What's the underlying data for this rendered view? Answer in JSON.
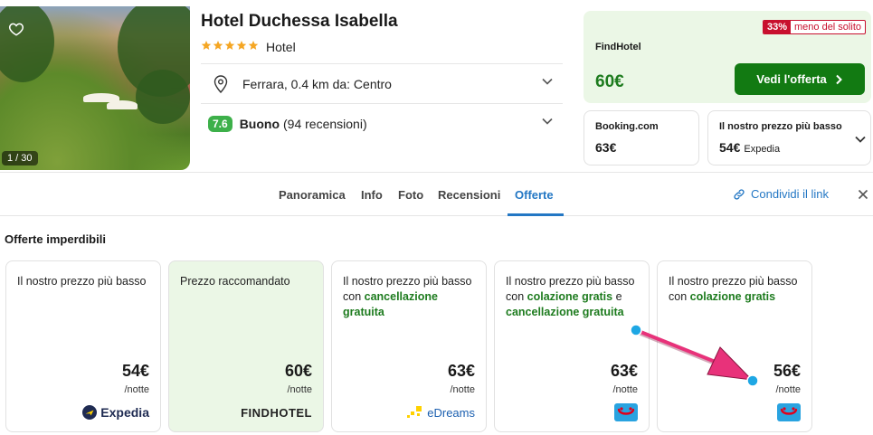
{
  "hotel": {
    "name": "Hotel Duchessa Isabella",
    "type": "Hotel",
    "star_count": 5,
    "photo_counter": "1 / 30",
    "location": "Ferrara, 0.4 km da: Centro",
    "rating_score": "7.6",
    "rating_word": "Buono",
    "reviews": "(94 recensioni)"
  },
  "top_deal": {
    "discount_pct": "33%",
    "discount_label": "meno del solito",
    "provider": "FindHotel",
    "price": "60€",
    "button_label": "Vedi l'offerta"
  },
  "other_prices": [
    {
      "provider": "Booking.com",
      "price": "63€",
      "sub": ""
    },
    {
      "provider": "Il nostro prezzo più basso",
      "price": "54€",
      "sub": "Expedia"
    }
  ],
  "tabs": [
    "Panoramica",
    "Info",
    "Foto",
    "Recensioni",
    "Offerte"
  ],
  "active_tab": "Offerte",
  "share_label": "Condividi il link",
  "section_title": "Offerte imperdibili",
  "offers": [
    {
      "desc_plain": "Il nostro prezzo più basso",
      "price": "54€",
      "unit": "/notte",
      "logo": "Expedia"
    },
    {
      "desc_plain": "Prezzo raccomandato",
      "price": "60€",
      "unit": "/notte",
      "logo": "FINDHOTEL"
    },
    {
      "desc_plain": "Il nostro prezzo più basso con",
      "desc_bold": "cancellazione gratuita",
      "price": "63€",
      "unit": "/notte",
      "logo": "eDreams"
    },
    {
      "desc_plain": "Il nostro prezzo più basso con",
      "desc_bold": "colazione gratis",
      "desc_plain2": "e",
      "desc_bold2": "cancellazione gratuita",
      "price": "63€",
      "unit": "/notte",
      "logo": "TUI"
    },
    {
      "desc_plain": "Il nostro prezzo più basso con",
      "desc_bold": "colazione gratis",
      "price": "56€",
      "unit": "/notte",
      "logo": "TUI"
    }
  ],
  "colors": {
    "accent_blue": "#2377c4",
    "deal_green": "#127a12",
    "deal_bg": "#ebf7e6",
    "discount_red": "#c8102e",
    "annotation_pink": "#e8327a",
    "annotation_dot": "#1ea7e4"
  }
}
